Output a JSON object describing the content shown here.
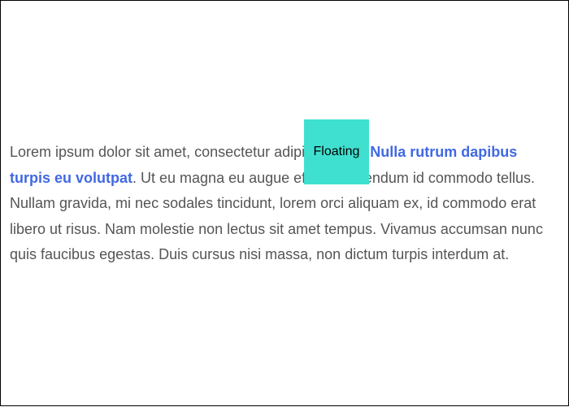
{
  "content": {
    "text_before_link": "Lorem ipsum dolor sit amet, consectetur adipiscing elit. ",
    "link_text": "Nulla rutrum dapibus turpis eu volutpat",
    "text_after_link": ". Ut eu magna eu augue efficitur bibendum id commodo tellus. Nullam gravida, mi nec sodales tincidunt, lorem orci aliquam ex, id commodo erat libero ut risus. Nam molestie non lectus sit amet tempus. Vivamus accumsan nunc quis faucibus egestas. Duis cursus nisi massa, non dictum turpis interdum at."
  },
  "floating": {
    "label": "Floating"
  },
  "colors": {
    "text": "#555555",
    "link": "#4169e1",
    "floating_background": "#40e0d0",
    "frame_border": "#000000"
  }
}
